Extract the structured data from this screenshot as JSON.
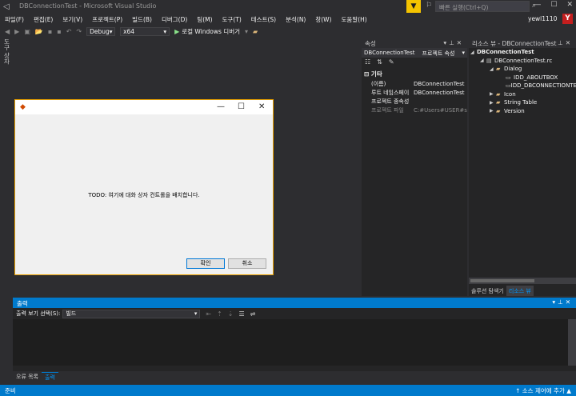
{
  "window": {
    "title": "DBConnectionTest - Microsoft Visual Studio",
    "quick_launch_placeholder": "빠른 실행(Ctrl+Q)",
    "user_name": "yewl1110",
    "user_initial": "Y"
  },
  "menu": {
    "items": [
      "파일(F)",
      "편집(E)",
      "보기(V)",
      "프로젝트(P)",
      "빌드(B)",
      "디버그(D)",
      "팀(M)",
      "도구(T)",
      "테스트(S)",
      "분석(N)",
      "창(W)",
      "도움말(H)"
    ]
  },
  "toolbar": {
    "configuration": "Debug",
    "platform": "x64",
    "run_label": "로컬 Windows 디버거"
  },
  "left_tab": {
    "label": "도구 상자"
  },
  "dialog": {
    "body_text": "TODO: 여기에 대화 상자 컨트롤을 배치합니다.",
    "ok_label": "확인",
    "cancel_label": "취소"
  },
  "properties": {
    "title": "속성",
    "object_name": "DBConnectionTest",
    "object_type": "프로젝트 속성",
    "category": "기타",
    "rows": [
      {
        "name": "(이름)",
        "value": "DBConnectionTest"
      },
      {
        "name": "루트 네임스페이",
        "value": "DBConnectionTest"
      },
      {
        "name": "프로젝트 종속성",
        "value": ""
      },
      {
        "name": "프로젝트 파일",
        "value": "C:#Users#USER#sou"
      }
    ]
  },
  "resource_view": {
    "title": "리소스 뷰 - DBConnectionTest",
    "tree": {
      "root": "DBConnectionTest",
      "rc_file": "DBConnectionTest.rc",
      "dialog_folder": "Dialog",
      "dialog_items": [
        "IDD_ABOUTBOX",
        "IDD_DBCONNECTIONTE"
      ],
      "other_folders": [
        "Icon",
        "String Table",
        "Version"
      ]
    },
    "tabs": [
      "솔루션 탐색기",
      "리소스 뷰"
    ]
  },
  "output": {
    "title": "출력",
    "source_label": "출력 보기 선택(S):",
    "source_value": "빌드"
  },
  "bottom_tabs": [
    "오류 목록",
    "출력"
  ],
  "status": {
    "text": "준비",
    "source_control": "↑ 소스 제어에 추가 ▲"
  }
}
